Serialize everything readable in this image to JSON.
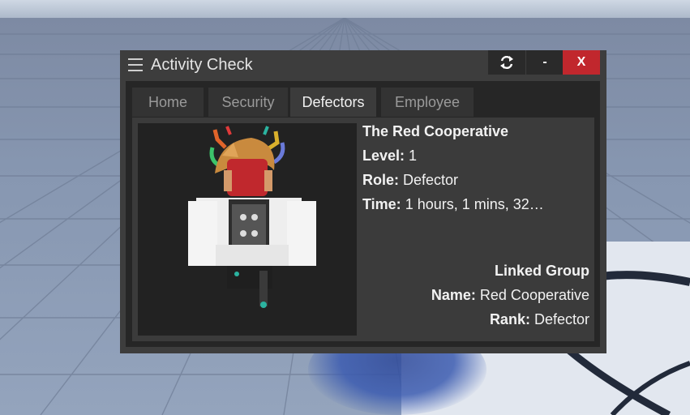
{
  "window": {
    "title": "Activity Check",
    "buttons": {
      "refresh_icon": "refresh-icon",
      "minimize_label": "-",
      "close_label": "X"
    }
  },
  "tabs": [
    {
      "label": "Home",
      "active": false
    },
    {
      "label": "Security",
      "active": false
    },
    {
      "label": "Defectors",
      "active": true
    },
    {
      "label": "Employee",
      "active": false
    }
  ],
  "profile": {
    "name": "The Red Cooperative",
    "level_label": "Level:",
    "level_value": "1",
    "role_label": "Role:",
    "role_value": "Defector",
    "time_label": "Time:",
    "time_value": "1 hours, 1 mins, 32…"
  },
  "linked_group": {
    "heading": "Linked Group",
    "name_label": "Name:",
    "name_value": "Red Cooperative",
    "rank_label": "Rank:",
    "rank_value": "Defector"
  },
  "colors": {
    "close_button": "#c1272d",
    "window_bg": "#3d3d3d",
    "panel_bg": "#262626",
    "content_bg": "#3b3b3b"
  }
}
